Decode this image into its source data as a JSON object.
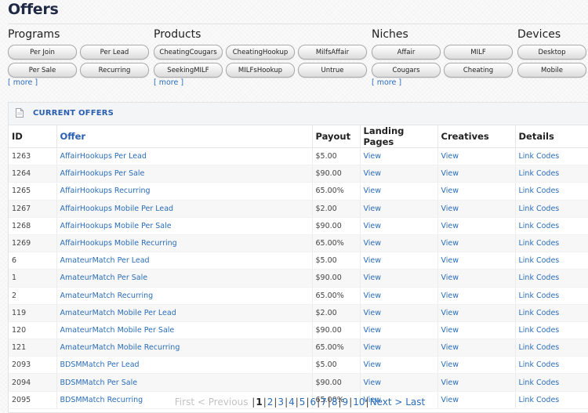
{
  "page": {
    "title": "Offers"
  },
  "filters": {
    "programs": {
      "title": "Programs",
      "buttons": [
        "Per Join",
        "Per Lead",
        "Per Sale",
        "Recurring"
      ],
      "more": "[ more ]"
    },
    "products": {
      "title": "Products",
      "buttons": [
        "CheatingCougars",
        "CheatingHookup",
        "MilfsAffair",
        "SeekingMILF",
        "MILFsHookup",
        "Untrue"
      ],
      "more": "[ more ]"
    },
    "niches": {
      "title": "Niches",
      "buttons": [
        "Affair",
        "MILF",
        "Cougars",
        "Cheating"
      ],
      "more": "[ more ]"
    },
    "devices": {
      "title": "Devices",
      "buttons": [
        "Desktop",
        "Mobile"
      ]
    }
  },
  "offers": {
    "panel_title": "CURRENT OFFERS",
    "columns": [
      "ID",
      "Offer",
      "Payout",
      "Landing Pages",
      "Creatives",
      "Details"
    ],
    "rows": [
      {
        "id": "1263",
        "offer": "AffairHookups Per Lead",
        "payout": "$5.00",
        "landing": "View",
        "creatives": "View",
        "details": "Link Codes"
      },
      {
        "id": "1264",
        "offer": "AffairHookups Per Sale",
        "payout": "$90.00",
        "landing": "View",
        "creatives": "View",
        "details": "Link Codes"
      },
      {
        "id": "1265",
        "offer": "AffairHookups Recurring",
        "payout": "65.00%",
        "landing": "View",
        "creatives": "View",
        "details": "Link Codes"
      },
      {
        "id": "1267",
        "offer": "AffairHookups Mobile Per Lead",
        "payout": "$2.00",
        "landing": "View",
        "creatives": "View",
        "details": "Link Codes"
      },
      {
        "id": "1268",
        "offer": "AffairHookups Mobile Per Sale",
        "payout": "$90.00",
        "landing": "View",
        "creatives": "View",
        "details": "Link Codes"
      },
      {
        "id": "1269",
        "offer": "AffairHookups Mobile Recurring",
        "payout": "65.00%",
        "landing": "View",
        "creatives": "View",
        "details": "Link Codes"
      },
      {
        "id": "6",
        "offer": "AmateurMatch Per Lead",
        "payout": "$5.00",
        "landing": "View",
        "creatives": "View",
        "details": "Link Codes"
      },
      {
        "id": "1",
        "offer": "AmateurMatch Per Sale",
        "payout": "$90.00",
        "landing": "View",
        "creatives": "View",
        "details": "Link Codes"
      },
      {
        "id": "2",
        "offer": "AmateurMatch Recurring",
        "payout": "65.00%",
        "landing": "View",
        "creatives": "View",
        "details": "Link Codes"
      },
      {
        "id": "119",
        "offer": "AmateurMatch Mobile Per Lead",
        "payout": "$2.00",
        "landing": "View",
        "creatives": "View",
        "details": "Link Codes"
      },
      {
        "id": "120",
        "offer": "AmateurMatch Mobile Per Sale",
        "payout": "$90.00",
        "landing": "View",
        "creatives": "View",
        "details": "Link Codes"
      },
      {
        "id": "121",
        "offer": "AmateurMatch Mobile Recurring",
        "payout": "65.00%",
        "landing": "View",
        "creatives": "View",
        "details": "Link Codes"
      },
      {
        "id": "2093",
        "offer": "BDSMMatch Per Lead",
        "payout": "$5.00",
        "landing": "View",
        "creatives": "View",
        "details": "Link Codes"
      },
      {
        "id": "2094",
        "offer": "BDSMMatch Per Sale",
        "payout": "$90.00",
        "landing": "View",
        "creatives": "View",
        "details": "Link Codes"
      },
      {
        "id": "2095",
        "offer": "BDSMMatch Recurring",
        "payout": "65.00%",
        "landing": "View",
        "creatives": "View",
        "details": "Link Codes"
      }
    ]
  },
  "pagination": {
    "first": "First",
    "previous": "< Previous",
    "pages": [
      "1",
      "2",
      "3",
      "4",
      "5",
      "6",
      "7",
      "8",
      "9",
      "10"
    ],
    "current": "1",
    "next": "Next >",
    "last": "Last"
  },
  "colors": {
    "link": "#2a6db8",
    "panel_title": "#2a5fb0",
    "title": "#1f2a44"
  }
}
